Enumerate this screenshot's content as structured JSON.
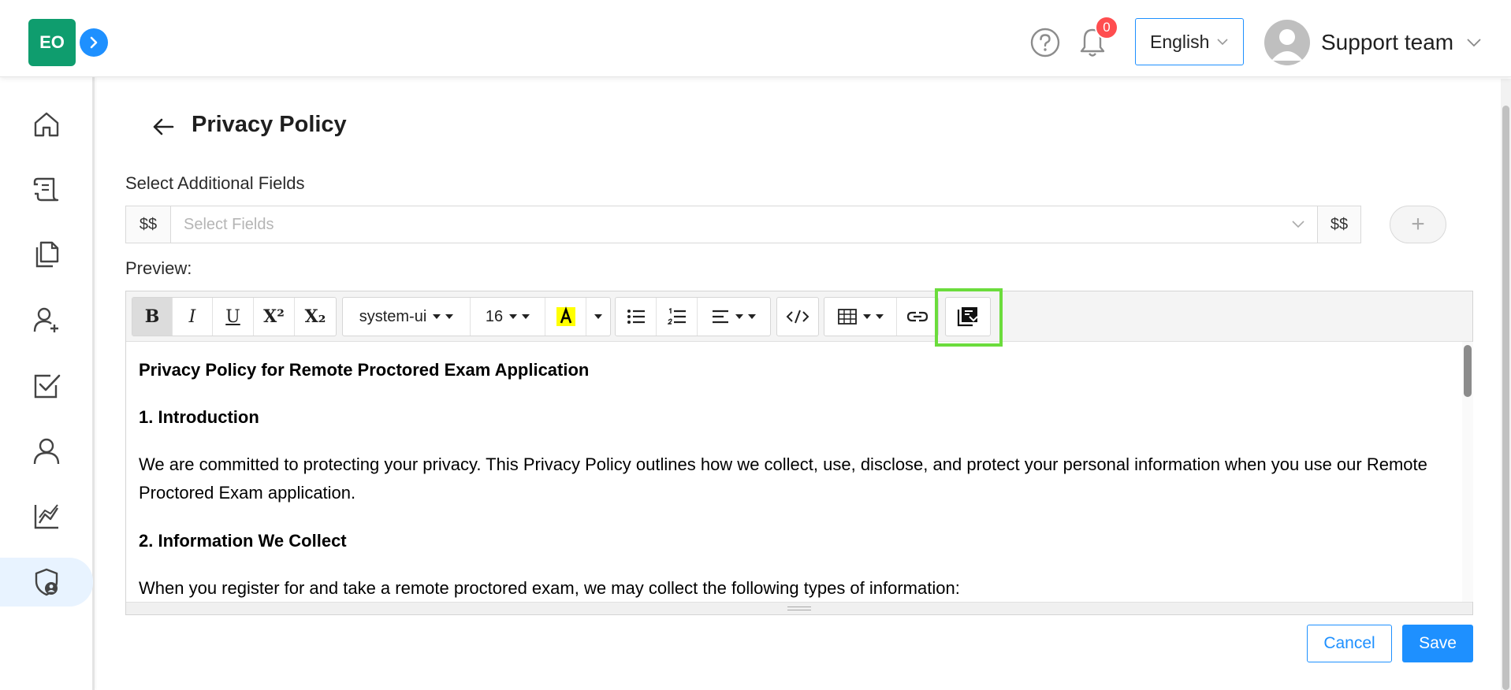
{
  "header": {
    "logo_text": "EO",
    "notification_count": "0",
    "language": "English",
    "user_name": "Support team"
  },
  "sidebar": {
    "items": [
      {
        "icon": "home-icon"
      },
      {
        "icon": "scroll-icon"
      },
      {
        "icon": "documents-icon"
      },
      {
        "icon": "add-user-icon"
      },
      {
        "icon": "checkbox-icon"
      },
      {
        "icon": "user-icon"
      },
      {
        "icon": "chart-icon"
      },
      {
        "icon": "shield-user-icon",
        "active": true
      }
    ]
  },
  "page": {
    "title": "Privacy Policy",
    "fields_label": "Select Additional Fields",
    "addon_left": "$$",
    "addon_right": "$$",
    "select_placeholder": "Select Fields",
    "plus": "+",
    "preview_label": "Preview:"
  },
  "toolbar": {
    "bold": "B",
    "italic": "I",
    "underline": "U",
    "superscript": "X²",
    "subscript": "X₂",
    "font_family": "system-ui",
    "font_size": "16",
    "highlight_color": "#ffff00"
  },
  "content": {
    "heading": "Privacy Policy for Remote Proctored Exam Application",
    "s1_title": "1. Introduction",
    "s1_text": "We are committed to protecting your privacy. This Privacy Policy outlines how we collect, use, disclose, and protect your personal information when you use our Remote Proctored Exam application.",
    "s2_title": "2. Information We Collect",
    "s2_text": "When you register for and take a remote proctored exam, we may collect the following types of information:"
  },
  "actions": {
    "cancel": "Cancel",
    "save": "Save"
  },
  "colors": {
    "primary": "#1e90ff",
    "logo": "#0f9d6e",
    "badge": "#ff4d4f",
    "focus_outline": "#6bdc3c"
  }
}
